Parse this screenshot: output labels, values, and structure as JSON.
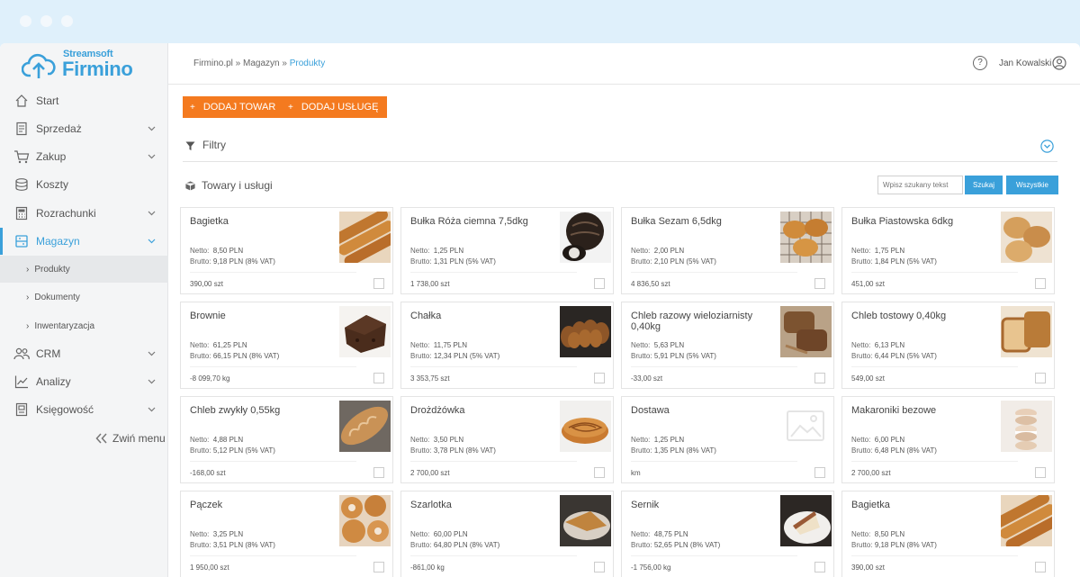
{
  "app": {
    "logo_small": "Streamsoft",
    "logo_big": "Firmino"
  },
  "sidebar": {
    "items": [
      {
        "label": "Start",
        "icon": "home-icon"
      },
      {
        "label": "Sprzedaż",
        "icon": "document-icon"
      },
      {
        "label": "Zakup",
        "icon": "cart-icon"
      },
      {
        "label": "Koszty",
        "icon": "coins-icon"
      },
      {
        "label": "Rozrachunki",
        "icon": "calculator-icon"
      },
      {
        "label": "Magazyn",
        "icon": "warehouse-icon"
      },
      {
        "label": "CRM",
        "icon": "users-icon"
      },
      {
        "label": "Analizy",
        "icon": "chart-icon"
      },
      {
        "label": "Księgowość",
        "icon": "ledger-icon"
      }
    ],
    "subitems": [
      {
        "label": "Produkty"
      },
      {
        "label": "Dokumenty"
      },
      {
        "label": "Inwentaryzacja"
      }
    ],
    "collapse_label": "Zwiń menu"
  },
  "topbar": {
    "breadcrumb": {
      "part1": "Firmino.pl",
      "sep": " » ",
      "part2": "Magazyn",
      "current": "Produkty"
    },
    "help": "?",
    "user": "Jan Kowalski"
  },
  "toolbar": {
    "add_product": "DODAJ TOWAR",
    "add_service": "DODAJ USŁUGĘ",
    "plus": "+"
  },
  "filters": {
    "label": "Filtry"
  },
  "list": {
    "title": "Towary i usługi",
    "search_placeholder": "Wpisz szukany tekst",
    "search_button": "Szukaj",
    "all_button": "Wszystkie",
    "netto_key": "Netto:",
    "brutto_key": "Brutto:",
    "products": [
      {
        "name": "Bagietka",
        "netto": "8,50 PLN",
        "brutto": "9,18 PLN (8% VAT)",
        "stock": "390,00 szt",
        "img": "baguette"
      },
      {
        "name": "Bułka Róża ciemna 7,5dkg",
        "netto": "1,25 PLN",
        "brutto": "1,31 PLN (5% VAT)",
        "stock": "1 738,00 szt",
        "img": "dark-roll"
      },
      {
        "name": "Bułka Sezam 6,5dkg",
        "netto": "2,00 PLN",
        "brutto": "2,10 PLN (5% VAT)",
        "stock": "4 836,50 szt",
        "img": "sesame-rolls"
      },
      {
        "name": "Bułka Piastowska 6dkg",
        "netto": "1,75 PLN",
        "brutto": "1,84 PLN (5% VAT)",
        "stock": "451,00 szt",
        "img": "rolls"
      },
      {
        "name": "Brownie",
        "netto": "61,25 PLN",
        "brutto": "66,15 PLN (8% VAT)",
        "stock": "-8 099,70 kg",
        "img": "brownie"
      },
      {
        "name": "Chałka",
        "netto": "11,75 PLN",
        "brutto": "12,34 PLN (5% VAT)",
        "stock": "3 353,75 szt",
        "img": "challah"
      },
      {
        "name": "Chleb razowy wieloziarnisty 0,40kg",
        "netto": "5,63 PLN",
        "brutto": "5,91 PLN (5% VAT)",
        "stock": "-33,00 szt",
        "img": "rye-bread"
      },
      {
        "name": "Chleb tostowy 0,40kg",
        "netto": "6,13 PLN",
        "brutto": "6,44 PLN (5% VAT)",
        "stock": "549,00 szt",
        "img": "toast-bread"
      },
      {
        "name": "Chleb zwykły 0,55kg",
        "netto": "4,88 PLN",
        "brutto": "5,12 PLN (5% VAT)",
        "stock": "-168,00 szt",
        "img": "bread"
      },
      {
        "name": "Drożdżówka",
        "netto": "3,50 PLN",
        "brutto": "3,78 PLN (8% VAT)",
        "stock": "2 700,00 szt",
        "img": "cinnamon-roll"
      },
      {
        "name": "Dostawa",
        "netto": "1,25 PLN",
        "brutto": "1,35 PLN (8% VAT)",
        "stock": "km",
        "img": "placeholder"
      },
      {
        "name": "Makaroniki bezowe",
        "netto": "6,00 PLN",
        "brutto": "6,48 PLN (8% VAT)",
        "stock": "2 700,00 szt",
        "img": "macarons"
      },
      {
        "name": "Pączek",
        "netto": "3,25 PLN",
        "brutto": "3,51 PLN (8% VAT)",
        "stock": "1 950,00 szt",
        "img": "donuts"
      },
      {
        "name": "Szarlotka",
        "netto": "60,00 PLN",
        "brutto": "64,80 PLN (8% VAT)",
        "stock": "-861,00 kg",
        "img": "apple-pie"
      },
      {
        "name": "Sernik",
        "netto": "48,75 PLN",
        "brutto": "52,65 PLN (8% VAT)",
        "stock": "-1 756,00 kg",
        "img": "cheesecake"
      },
      {
        "name": "Bagietka",
        "netto": "8,50 PLN",
        "brutto": "9,18 PLN (8% VAT)",
        "stock": "390,00 szt",
        "img": "baguette"
      }
    ]
  },
  "colors": {
    "accent": "#3aa0da",
    "orange": "#f47a1f",
    "sidebar_bg": "#f4f5f6"
  }
}
